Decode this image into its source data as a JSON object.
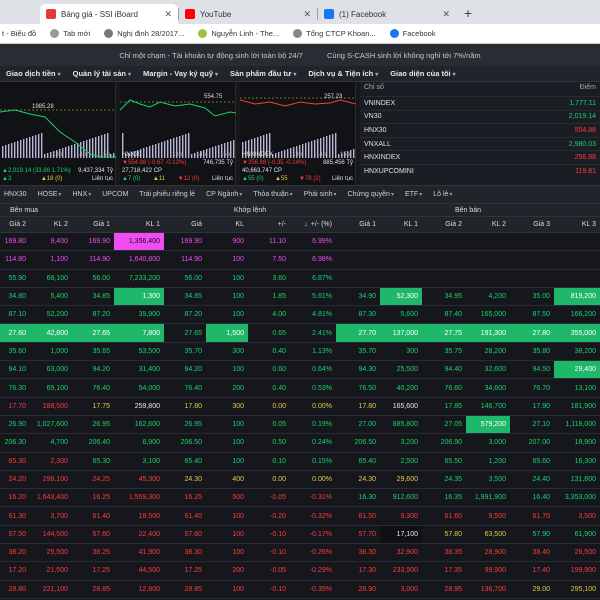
{
  "browser": {
    "tabs": [
      {
        "title": "Bảng giá - SSI iBoard",
        "color": "#e53935",
        "active": true
      },
      {
        "title": "YouTube",
        "color": "#ff0000",
        "active": false
      },
      {
        "title": "(1) Facebook",
        "color": "#1877f2",
        "active": false
      }
    ],
    "close_glyph": "✕",
    "newtab_glyph": "+",
    "bookmarks": [
      {
        "label": "t - Biểu đồ",
        "color": "#999999"
      },
      {
        "label": "Tab mới",
        "color": "#999999"
      },
      {
        "label": "Nghị định 28/2017...",
        "color": "#777777"
      },
      {
        "label": "Nguyễn Linh - The...",
        "color": "#a0c040"
      },
      {
        "label": "Tổng CTCP Khoan...",
        "color": "#888888"
      },
      {
        "label": "Facebook",
        "color": "#1877f2"
      }
    ]
  },
  "promo": {
    "left": "Chỉ một chạm - Tài khoản tự động sinh lời toàn bộ 24/7",
    "right": "Cùng S-CASH sinh lời không nghỉ tới 7%/năm"
  },
  "nav": [
    "Giao dịch tiền",
    "Quản lý tài sản",
    "Margin - Vay ký quỹ",
    "Sản phẩm đầu tư",
    "Dịch vụ & Tiện ích",
    "Giao diện của tôi"
  ],
  "charts": [
    {
      "label": "1985.28",
      "ticks": [
        "13h",
        "14h",
        "15h"
      ],
      "r1l": "▲2,019.14 (33.86 1.71%)",
      "r1r": "9,437,334 Tỷ",
      "r2l": "▲3",
      "r2m": "▲18 (0)",
      "r2r": "Liên tục",
      "r1color": "green"
    },
    {
      "label": "554.75",
      "ticks": [
        "13h",
        "14h",
        "15h"
      ],
      "name": "HNX30",
      "r1l": "▼554.88 (-0.67 -0.12%)",
      "r1r": "27,718,422 CP",
      "r2l": "▲7 (0)",
      "r2m": "▲11",
      "r2r": "Liên tục",
      "r1color": "red",
      "r1rv": "746,735 Tỷ",
      "r2x": "▼12 (0)"
    },
    {
      "label": "257.23",
      "ticks": [
        "13h",
        "14h",
        "15h"
      ],
      "name": "HNXINDEX",
      "r1l": "▼256.88 (-0.35 -0.14%)",
      "r1r": "40,663,747 CP",
      "r2l": "▲55 (0)",
      "r2m": "▲55",
      "r2r": "Liên tục",
      "r1color": "red",
      "r1rv": "885,456 Tỷ",
      "r2x": "▼78 (2)"
    }
  ],
  "indices": {
    "header": {
      "name": "Chỉ số",
      "value": "Điểm"
    },
    "rows": [
      {
        "name": "VNINDEX",
        "value": "1,777.11",
        "color": "green"
      },
      {
        "name": "VN30",
        "value": "2,019.14",
        "color": "green"
      },
      {
        "name": "HNX30",
        "value": "554.88",
        "color": "red"
      },
      {
        "name": "VNXALL",
        "value": "2,980.03",
        "color": "green"
      },
      {
        "name": "HNXINDEX",
        "value": "256.88",
        "color": "red"
      },
      {
        "name": "HNXUPCOMINI",
        "value": "119.81",
        "color": "red"
      }
    ]
  },
  "filters": [
    "HNX30",
    "HOSE",
    "HNX",
    "UPCOM",
    "Trái phiếu riêng lẻ",
    "CP Ngành",
    "Thỏa thuận",
    "Phái sinh",
    "Chứng quyền",
    "ETF",
    "Lô lẻ"
  ],
  "groups": {
    "buy": "Bên mua",
    "match": "Khớp lệnh",
    "sell": "Bên bán"
  },
  "columns": [
    "Giá 2",
    "KL 2",
    "Giá 1",
    "KL 1",
    "Giá",
    "KL",
    "+/-",
    "+/- (%)",
    "Giá 1",
    "KL 1",
    "Giá 2",
    "KL 2",
    "Giá 3",
    "KL 3"
  ],
  "sort_glyph": "↓",
  "rows": [
    {
      "c": [
        "169.80",
        "9,400",
        "169.90",
        "1,356,400",
        "169.90",
        "900",
        "11.10",
        "6.99%",
        "",
        "",
        "",
        "",
        "",
        ""
      ],
      "k": [
        "purple",
        "purple",
        "purple",
        "bgp",
        "purple",
        "purple",
        "purple",
        "purple",
        "",
        "",
        "",
        "",
        "",
        ""
      ]
    },
    {
      "c": [
        "114.80",
        "1,100",
        "114.90",
        "1,640,800",
        "114.90",
        "100",
        "7.50",
        "6.98%",
        "",
        "",
        "",
        "",
        "",
        ""
      ],
      "k": [
        "purple",
        "purple",
        "purple",
        "purple",
        "purple",
        "purple",
        "purple",
        "purple",
        "",
        "",
        "",
        "",
        "",
        ""
      ]
    },
    {
      "c": [
        "55.90",
        "68,100",
        "56.00",
        "7,233,200",
        "56.00",
        "100",
        "3.60",
        "6.87%",
        "",
        "",
        "",
        "",
        "",
        ""
      ],
      "k": [
        "green",
        "green",
        "green",
        "green",
        "green",
        "green",
        "green",
        "green",
        "",
        "",
        "",
        "",
        "",
        ""
      ]
    },
    {
      "c": [
        "34.80",
        "5,400",
        "34.85",
        "1,300",
        "34.85",
        "100",
        "1.85",
        "5.61%",
        "34.90",
        "52,300",
        "34.95",
        "4,200",
        "35.00",
        "819,200"
      ],
      "k": [
        "green",
        "green",
        "green",
        "bgg",
        "green",
        "green",
        "green",
        "green",
        "green",
        "bgg",
        "green",
        "green",
        "green",
        "bgg"
      ]
    },
    {
      "c": [
        "87.10",
        "52,200",
        "87.20",
        "35,900",
        "87.20",
        "100",
        "4.00",
        "4.81%",
        "87.30",
        "5,600",
        "87.40",
        "165,000",
        "87.50",
        "166,200"
      ],
      "k": [
        "green",
        "green",
        "green",
        "green",
        "green",
        "green",
        "green",
        "green",
        "green",
        "green",
        "green",
        "green",
        "green",
        "green"
      ]
    },
    {
      "c": [
        "27.60",
        "42,800",
        "27.65",
        "7,800",
        "27.65",
        "1,500",
        "0.65",
        "2.41%",
        "27.70",
        "137,000",
        "27.75",
        "191,300",
        "27.80",
        "355,000"
      ],
      "k": [
        "bgg",
        "bgg",
        "bgg",
        "bgg",
        "green",
        "bgg",
        "green",
        "green",
        "bgg",
        "bgg",
        "bgg",
        "bgg",
        "bgg",
        "bgg"
      ]
    },
    {
      "c": [
        "35.60",
        "1,000",
        "35.65",
        "53,500",
        "35.70",
        "300",
        "0.40",
        "1.13%",
        "35.70",
        "300",
        "35.75",
        "28,200",
        "35.80",
        "38,200"
      ],
      "k": [
        "green",
        "green",
        "green",
        "green",
        "green",
        "green",
        "green",
        "green",
        "green",
        "green",
        "green",
        "green",
        "green",
        "green"
      ]
    },
    {
      "c": [
        "94.10",
        "63,000",
        "94.20",
        "31,400",
        "94.20",
        "100",
        "0.60",
        "0.64%",
        "94.30",
        "25,500",
        "94.40",
        "32,600",
        "94.50",
        "29,400"
      ],
      "k": [
        "green",
        "green",
        "green",
        "green",
        "green",
        "green",
        "green",
        "green",
        "green",
        "green",
        "green",
        "green",
        "green",
        "bgg"
      ]
    },
    {
      "c": [
        "76.30",
        "69,100",
        "76.40",
        "54,000",
        "76.40",
        "200",
        "0.40",
        "0.53%",
        "76.50",
        "40,200",
        "76.60",
        "34,600",
        "76.70",
        "13,100"
      ],
      "k": [
        "green",
        "green",
        "green",
        "green",
        "green",
        "green",
        "green",
        "green",
        "green",
        "green",
        "green",
        "green",
        "green",
        "green"
      ]
    },
    {
      "c": [
        "17.70",
        "188,500",
        "17.75",
        "259,800",
        "17.80",
        "300",
        "0.00",
        "0.00%",
        "17.80",
        "165,600",
        "17.85",
        "146,700",
        "17.90",
        "181,900"
      ],
      "k": [
        "red",
        "red",
        "yellow",
        "white",
        "yellow",
        "yellow",
        "yellow",
        "yellow",
        "yellow",
        "white",
        "green",
        "green",
        "green",
        "green"
      ]
    },
    {
      "c": [
        "26.90",
        "1,027,600",
        "26.95",
        "162,600",
        "26.95",
        "100",
        "0.05",
        "0.19%",
        "27.00",
        "885,800",
        "27.05",
        "579,200",
        "27.10",
        "1,118,000"
      ],
      "k": [
        "green",
        "green",
        "green",
        "green",
        "green",
        "green",
        "green",
        "green",
        "green",
        "green",
        "green",
        "bgg",
        "green",
        "green"
      ]
    },
    {
      "c": [
        "206.30",
        "4,700",
        "206.40",
        "6,900",
        "206.50",
        "100",
        "0.50",
        "0.24%",
        "206.50",
        "3,200",
        "206.90",
        "3,000",
        "207.00",
        "18,900"
      ],
      "k": [
        "green",
        "green",
        "green",
        "green",
        "green",
        "green",
        "green",
        "green",
        "green",
        "green",
        "green",
        "green",
        "green",
        "green"
      ]
    },
    {
      "c": [
        "65.30",
        "2,300",
        "65.30",
        "3,100",
        "65.40",
        "100",
        "0.10",
        "0.15%",
        "65.40",
        "2,500",
        "65.50",
        "1,200",
        "65.60",
        "16,300"
      ],
      "k": [
        "red",
        "red",
        "green",
        "green",
        "green",
        "green",
        "green",
        "green",
        "green",
        "green",
        "green",
        "green",
        "green",
        "green"
      ]
    },
    {
      "c": [
        "24.20",
        "298,100",
        "24.25",
        "45,300",
        "24.30",
        "400",
        "0.00",
        "0.00%",
        "24.30",
        "29,600",
        "24.35",
        "3,500",
        "24.40",
        "131,600"
      ],
      "k": [
        "red",
        "red",
        "red",
        "red",
        "yellow",
        "yellow",
        "yellow",
        "yellow",
        "yellow",
        "yellow",
        "green",
        "green",
        "green",
        "green"
      ]
    },
    {
      "c": [
        "16.20",
        "1,643,400",
        "16.25",
        "1,559,300",
        "16.25",
        "500",
        "-0.05",
        "-0.31%",
        "16.30",
        "912,600",
        "16.35",
        "1,991,900",
        "16.40",
        "3,353,000"
      ],
      "k": [
        "red",
        "red",
        "red",
        "red",
        "red",
        "red",
        "red",
        "red",
        "green",
        "green",
        "green",
        "green",
        "green",
        "green"
      ]
    },
    {
      "c": [
        "61.30",
        "3,700",
        "61.40",
        "18,500",
        "61.40",
        "100",
        "-0.20",
        "-0.32%",
        "61.50",
        "9,300",
        "61.60",
        "9,500",
        "61.70",
        "3,500"
      ],
      "k": [
        "red",
        "red",
        "red",
        "red",
        "red",
        "red",
        "red",
        "red",
        "red",
        "red",
        "red",
        "red",
        "red",
        "red"
      ]
    },
    {
      "c": [
        "57.50",
        "144,500",
        "57.60",
        "22,400",
        "57.60",
        "100",
        "-0.10",
        "-0.17%",
        "57.70",
        "17,100",
        "57.80",
        "63,500",
        "57.90",
        "61,900"
      ],
      "k": [
        "red",
        "red",
        "red",
        "red",
        "red",
        "red",
        "red",
        "red",
        "red",
        "bgr",
        "yellow",
        "yellow",
        "green",
        "green"
      ]
    },
    {
      "c": [
        "38.20",
        "25,500",
        "38.25",
        "41,900",
        "38.30",
        "100",
        "-0.10",
        "-0.26%",
        "38.30",
        "32,900",
        "38.35",
        "28,900",
        "38.40",
        "26,500"
      ],
      "k": [
        "red",
        "red",
        "red",
        "red",
        "red",
        "red",
        "red",
        "red",
        "red",
        "red",
        "red",
        "red",
        "red",
        "red"
      ]
    },
    {
      "c": [
        "17.20",
        "21,500",
        "17.25",
        "44,500",
        "17.25",
        "200",
        "-0.05",
        "-0.29%",
        "17.30",
        "233,900",
        "17.35",
        "99,900",
        "17.40",
        "199,900"
      ],
      "k": [
        "red",
        "red",
        "red",
        "red",
        "red",
        "red",
        "red",
        "red",
        "red",
        "red",
        "red",
        "red",
        "red",
        "red"
      ]
    },
    {
      "c": [
        "28.80",
        "221,100",
        "28.85",
        "12,800",
        "28.85",
        "100",
        "-0.10",
        "-0.35%",
        "28.90",
        "3,000",
        "28.95",
        "136,700",
        "29.00",
        "295,100"
      ],
      "k": [
        "red",
        "red",
        "red",
        "red",
        "red",
        "red",
        "red",
        "red",
        "red",
        "red",
        "red",
        "red",
        "yellow",
        "yellow"
      ]
    },
    {
      "c": [
        "20.50",
        "12,000",
        "20.55",
        "154,000",
        "20.60",
        "100",
        "-0.15",
        "-0.72%",
        "20.60",
        "15,300",
        "20.65",
        "43,200",
        "20.70",
        "73,600"
      ],
      "k": [
        "red",
        "red",
        "red",
        "red",
        "red",
        "red",
        "red",
        "red",
        "red",
        "red",
        "red",
        "red",
        "red",
        "red"
      ]
    }
  ]
}
